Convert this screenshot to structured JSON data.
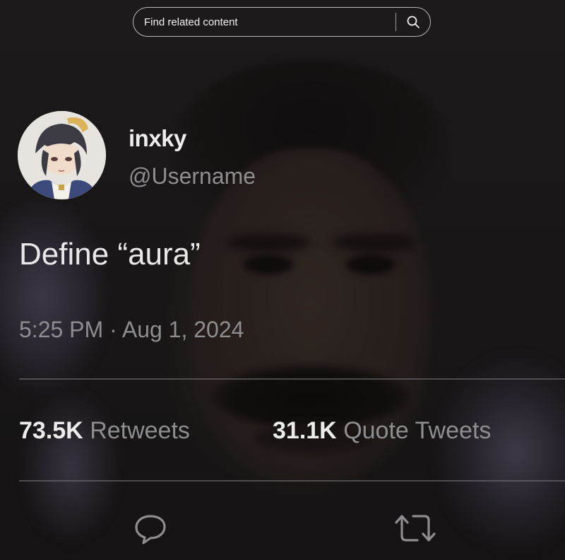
{
  "search": {
    "placeholder": "Find related content",
    "icon": "search-icon"
  },
  "tweet": {
    "display_name": "inxky",
    "handle": "@Username",
    "text": "Define “aura”",
    "time": "5:25 PM",
    "separator": "·",
    "date": "Aug 1, 2024",
    "stats": [
      {
        "count": "73.5K",
        "label": "Retweets"
      },
      {
        "count": "31.1K",
        "label": "Quote Tweets"
      }
    ],
    "actions": [
      {
        "name": "reply",
        "icon": "reply-icon"
      },
      {
        "name": "retweet",
        "icon": "retweet-icon"
      }
    ]
  },
  "colors": {
    "text_primary": "#ececec",
    "text_secondary": "#8e8e90",
    "background": "#1e1c1d"
  }
}
